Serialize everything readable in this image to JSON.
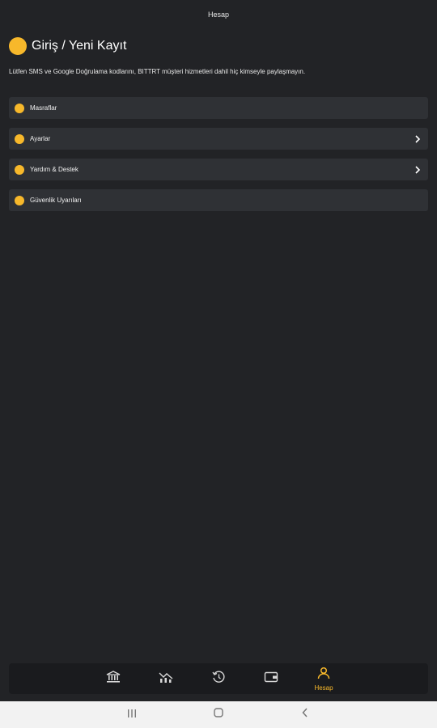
{
  "header": {
    "title": "Hesap"
  },
  "login": {
    "label": "Giriş / Yeni Kayıt"
  },
  "notice": {
    "text": "Lütfen SMS ve Google Doğrulama kodlarını, BITTRT müşteri hizmetleri dahil hiç kimseyle paylaşmayın."
  },
  "menu": {
    "items": [
      {
        "label": "Masraflar",
        "has_chevron": false
      },
      {
        "label": "Ayarlar",
        "has_chevron": true
      },
      {
        "label": "Yardım & Destek",
        "has_chevron": true
      },
      {
        "label": "Güvenlik Uyarıları",
        "has_chevron": false
      }
    ]
  },
  "bottom_nav": {
    "items": [
      {
        "icon": "bank-icon",
        "label": ""
      },
      {
        "icon": "market-chart-icon",
        "label": ""
      },
      {
        "icon": "history-icon",
        "label": ""
      },
      {
        "icon": "wallet-icon",
        "label": ""
      },
      {
        "icon": "user-icon",
        "label": "Hesap",
        "active": true
      }
    ]
  },
  "colors": {
    "accent": "#f7b82b",
    "background": "#222326",
    "card": "#2f3135",
    "nav": "#1a1b1e"
  },
  "system_nav": {
    "icons": [
      "recent-apps-icon",
      "home-icon",
      "back-icon"
    ]
  }
}
